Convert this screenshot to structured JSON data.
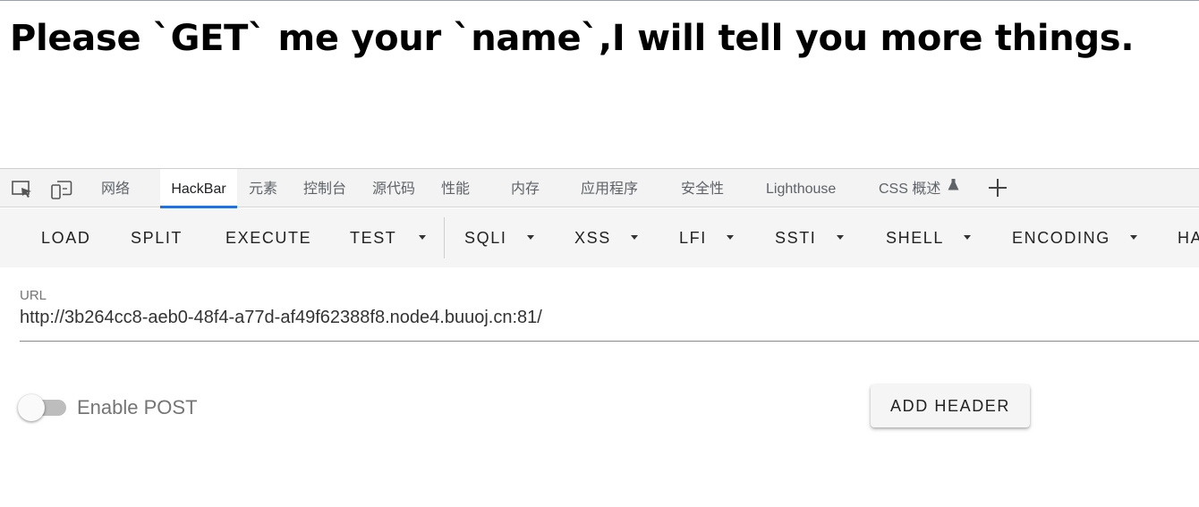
{
  "page": {
    "heading": "Please `GET` me your `name`,I will tell you more things."
  },
  "devtools": {
    "tabs": [
      {
        "label": "网络"
      },
      {
        "label": "HackBar"
      },
      {
        "label": "元素"
      },
      {
        "label": "控制台"
      },
      {
        "label": "源代码"
      },
      {
        "label": "性能"
      },
      {
        "label": "内存"
      },
      {
        "label": "应用程序"
      },
      {
        "label": "安全性"
      },
      {
        "label": "Lighthouse"
      },
      {
        "label": "CSS 概述"
      }
    ],
    "active_tab": "HackBar",
    "icons": [
      "inspect-element-icon",
      "device-toolbar-icon",
      "flask-icon",
      "plus-icon"
    ],
    "accent_color": "#1a73e8"
  },
  "hackbar": {
    "menu": [
      {
        "label": "LOAD"
      },
      {
        "label": "SPLIT"
      },
      {
        "label": "EXECUTE"
      },
      {
        "label": "TEST"
      },
      {
        "label": "SQLI"
      },
      {
        "label": "XSS"
      },
      {
        "label": "LFI"
      },
      {
        "label": "SSTI"
      },
      {
        "label": "SHELL"
      },
      {
        "label": "ENCODING"
      },
      {
        "label": "HA"
      }
    ],
    "url_label": "URL",
    "url_value": "http://3b264cc8-aeb0-48f4-a77d-af49f62388f8.node4.buuoj.cn:81/",
    "enable_post_label": "Enable POST",
    "enable_post_on": false,
    "add_header_label": "ADD HEADER"
  }
}
